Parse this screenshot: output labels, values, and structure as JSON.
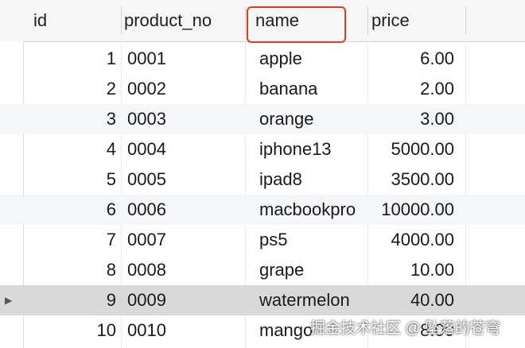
{
  "columns": [
    {
      "label": "id"
    },
    {
      "label": "product_no"
    },
    {
      "label": "name"
    },
    {
      "label": "price"
    }
  ],
  "rows": [
    {
      "id": "1",
      "product_no": "0001",
      "name": "apple",
      "price": "6.00"
    },
    {
      "id": "2",
      "product_no": "0002",
      "name": "banana",
      "price": "2.00"
    },
    {
      "id": "3",
      "product_no": "0003",
      "name": "orange",
      "price": "3.00"
    },
    {
      "id": "4",
      "product_no": "0004",
      "name": "iphone13",
      "price": "5000.00"
    },
    {
      "id": "5",
      "product_no": "0005",
      "name": "ipad8",
      "price": "3500.00"
    },
    {
      "id": "6",
      "product_no": "0006",
      "name": "macbookpro",
      "price": "10000.00"
    },
    {
      "id": "7",
      "product_no": "0007",
      "name": "ps5",
      "price": "4000.00"
    },
    {
      "id": "8",
      "product_no": "0008",
      "name": "grape",
      "price": "10.00"
    },
    {
      "id": "9",
      "product_no": "0009",
      "name": "watermelon",
      "price": "40.00"
    },
    {
      "id": "10",
      "product_no": "0010",
      "name": "mango",
      "price": "8.00"
    }
  ],
  "row_marker": "▶",
  "watermark": "掘金技术社区 @ 坠落的苍穹",
  "colors": {
    "highlight": "#e23a2a",
    "selected_row": "#d9d9d9",
    "stripe": "#f5f6f8"
  }
}
